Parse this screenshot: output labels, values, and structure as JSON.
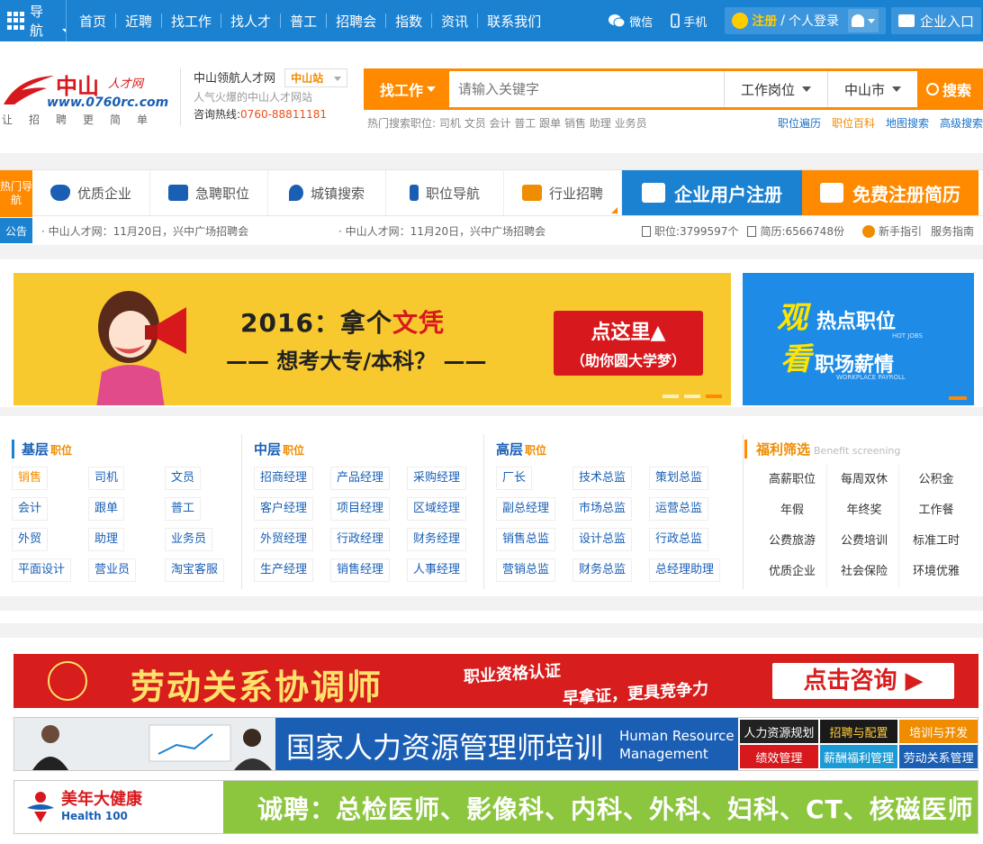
{
  "topbar": {
    "menu_label": "导航",
    "nav": [
      "首页",
      "近聘",
      "找工作",
      "找人才",
      "普工",
      "招聘会",
      "指数",
      "资讯",
      "联系我们"
    ],
    "wechat": "微信",
    "mobile": "手机",
    "register": "注册",
    "slash": "/",
    "login": "个人登录",
    "enterprise": "企业入口"
  },
  "header": {
    "logo_brand": "中山",
    "logo_brand2": "人才网",
    "logo_url": "www.0760rc.com",
    "logo_slogan": "让招聘更简单",
    "site_name": "中山领航人才网",
    "station": "中山站",
    "site_sub": "人气火爆的中山人才网站",
    "hotline_label": "咨询热线:",
    "hotline": "0760-88811181"
  },
  "search": {
    "kind": "找工作",
    "placeholder": "请输入关键字",
    "position_select": "工作岗位",
    "city_select": "中山市",
    "button": "搜索",
    "hot_label": "热门搜索职位:",
    "hot_terms": "司机 文员 会计 普工 跟单 销售 助理 业务员",
    "links": [
      "职位遍历",
      "职位百科",
      "地图搜索",
      "高级搜索"
    ]
  },
  "catbar": {
    "label": "热门导航",
    "items": [
      "优质企业",
      "急聘职位",
      "城镇搜索",
      "职位导航",
      "行业招聘"
    ],
    "biz_register": "企业用户注册",
    "cv_register": "免费注册简历"
  },
  "notice": {
    "tag": "公告",
    "items": [
      "· 中山人才网：11月20日，兴中广场招聘会",
      "· 中山人才网：11月20日，兴中广场招聘会"
    ],
    "jobs_count": "职位:3799597个",
    "resume_count": "简历:6566748份",
    "guide": "新手指引",
    "service": "服务指南"
  },
  "banner_main": {
    "line1_prefix": "2016：拿个",
    "line1_red": "文凭",
    "line2": "—— 想考大专/本科？ ——",
    "cta_main": "点这里▲",
    "cta_sub": "（助你圆大学梦）"
  },
  "banner_side": {
    "k1": "观",
    "t1": "热点职位",
    "en1": "HOT JOBS",
    "k2": "看",
    "t2": "职场薪情",
    "en2": "WORKPLACE PAYROLL"
  },
  "jobs": {
    "basic": {
      "title": "基层",
      "suffix": "职位",
      "items": [
        "销售",
        "司机",
        "文员",
        "会计",
        "跟单",
        "普工",
        "外贸",
        "助理",
        "业务员",
        "平面设计",
        "营业员",
        "淘宝客服"
      ]
    },
    "middle": {
      "title": "中层",
      "suffix": "职位",
      "items": [
        "招商经理",
        "产品经理",
        "采购经理",
        "客户经理",
        "项目经理",
        "区域经理",
        "外贸经理",
        "行政经理",
        "财务经理",
        "生产经理",
        "销售经理",
        "人事经理"
      ]
    },
    "senior": {
      "title": "高层",
      "suffix": "职位",
      "items": [
        "厂长",
        "技术总监",
        "策划总监",
        "副总经理",
        "市场总监",
        "运营总监",
        "销售总监",
        "设计总监",
        "行政总监",
        "营销总监",
        "财务总监",
        "总经理助理"
      ]
    },
    "welfare": {
      "title": "福利筛选",
      "en": "Benefit screening",
      "items": [
        "高薪职位",
        "每周双休",
        "公积金",
        "年假",
        "年终奖",
        "工作餐",
        "公费旅游",
        "公费培训",
        "标准工时",
        "优质企业",
        "社会保险",
        "环境优雅"
      ]
    }
  },
  "ads": {
    "ad1_title": "劳动关系协调师",
    "ad1_sub1": "职业资格认证",
    "ad1_sub2": "早拿证，更具竞争力",
    "ad1_cta": "点击咨询 ▶",
    "ad2_cn": "国家人力资源管理师培训",
    "ad2_en": "Human Resource Management",
    "ad2_tags": [
      "人力资源规划",
      "招聘与配置",
      "培训与开发",
      "绩效管理",
      "薪酬福利管理",
      "劳动关系管理"
    ],
    "ad2_tag_colors": [
      "#222222",
      "#1a1a1a",
      "#f08c00",
      "#d7191d",
      "#1b9bd6",
      "#1b5fb5"
    ],
    "ad3_brand": "美年大健康",
    "ad3_brand_en": "Health 100",
    "ad3_text": "诚聘：总检医师、影像科、内科、外科、妇科、CT、核磁医师"
  }
}
